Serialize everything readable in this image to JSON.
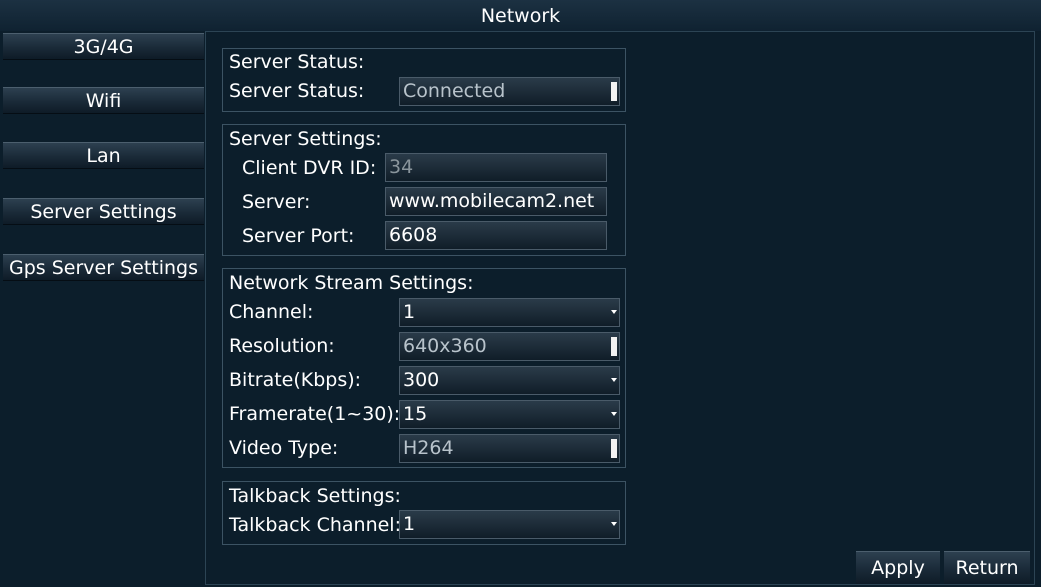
{
  "window": {
    "title": "Network"
  },
  "sidebar": {
    "items": [
      {
        "label": "3G/4G"
      },
      {
        "label": "Wifi"
      },
      {
        "label": "Lan"
      },
      {
        "label": "Server Settings"
      },
      {
        "label": "Gps Server Settings"
      }
    ]
  },
  "server_status": {
    "heading": "Server Status:",
    "status_label": "Server Status:",
    "status_value": "Connected"
  },
  "server_settings": {
    "heading": "Server Settings:",
    "dvr_id_label": "Client DVR ID:",
    "dvr_id_value": "34",
    "server_label": "Server:",
    "server_value": "www.mobilecam2.net",
    "port_label": "Server Port:",
    "port_value": "6608"
  },
  "stream_settings": {
    "heading": "Network Stream Settings:",
    "channel_label": "Channel:",
    "channel_value": "1",
    "resolution_label": "Resolution:",
    "resolution_value": "640x360",
    "bitrate_label": "Bitrate(Kbps):",
    "bitrate_value": "300",
    "framerate_label": "Framerate(1~30):",
    "framerate_value": "15",
    "video_type_label": "Video Type:",
    "video_type_value": "H264"
  },
  "talkback_settings": {
    "heading": "Talkback Settings:",
    "channel_label": "Talkback Channel:",
    "channel_value": "1"
  },
  "actions": {
    "apply_label": "Apply",
    "return_label": "Return"
  }
}
